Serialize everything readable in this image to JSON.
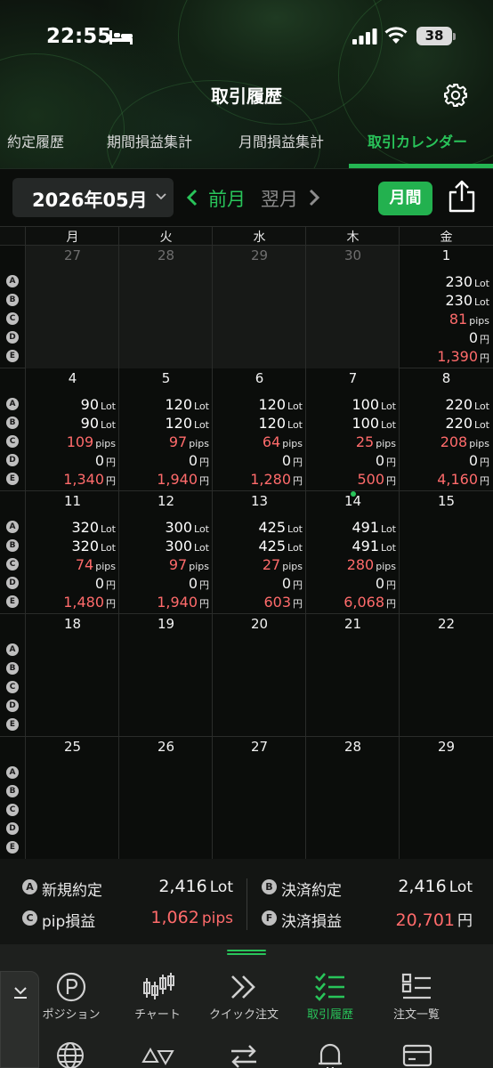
{
  "status": {
    "time": "22:55",
    "battery": "38"
  },
  "header": {
    "title": "取引履歴"
  },
  "tabs": [
    {
      "label": "約定履歴"
    },
    {
      "label": "期間損益集計"
    },
    {
      "label": "月間損益集計"
    },
    {
      "label": "取引カレンダー"
    }
  ],
  "month_bar": {
    "month": "2026年05月",
    "prev_label": "前月",
    "next_label": "翌月",
    "monthly_label": "月間"
  },
  "calendar": {
    "weekdays": [
      "月",
      "火",
      "水",
      "木",
      "金"
    ],
    "row_keys": [
      "A",
      "B",
      "C",
      "D",
      "E"
    ],
    "weeks": [
      {
        "days": [
          {
            "date": "27",
            "other_month": true
          },
          {
            "date": "28",
            "other_month": true
          },
          {
            "date": "29",
            "other_month": true
          },
          {
            "date": "30",
            "other_month": true
          },
          {
            "date": "1",
            "a": "230",
            "b": "230",
            "c": "81",
            "d": "0",
            "e": "1,390"
          }
        ]
      },
      {
        "days": [
          {
            "date": "4",
            "a": "90",
            "b": "90",
            "c": "109",
            "d": "0",
            "e": "1,340"
          },
          {
            "date": "5",
            "a": "120",
            "b": "120",
            "c": "97",
            "d": "0",
            "e": "1,940"
          },
          {
            "date": "6",
            "a": "120",
            "b": "120",
            "c": "64",
            "d": "0",
            "e": "1,280"
          },
          {
            "date": "7",
            "a": "100",
            "b": "100",
            "c": "25",
            "d": "0",
            "e": "500"
          },
          {
            "date": "8",
            "a": "220",
            "b": "220",
            "c": "208",
            "d": "0",
            "e": "4,160"
          }
        ]
      },
      {
        "days": [
          {
            "date": "11",
            "a": "320",
            "b": "320",
            "c": "74",
            "d": "0",
            "e": "1,480"
          },
          {
            "date": "12",
            "a": "300",
            "b": "300",
            "c": "97",
            "d": "0",
            "e": "1,940"
          },
          {
            "date": "13",
            "a": "425",
            "b": "425",
            "c": "27",
            "d": "0",
            "e": "603"
          },
          {
            "date": "14",
            "today": true,
            "a": "491",
            "b": "491",
            "c": "280",
            "d": "0",
            "e": "6,068"
          },
          {
            "date": "15"
          }
        ]
      },
      {
        "days": [
          {
            "date": "18"
          },
          {
            "date": "19"
          },
          {
            "date": "20"
          },
          {
            "date": "21"
          },
          {
            "date": "22"
          }
        ]
      },
      {
        "days": [
          {
            "date": "25"
          },
          {
            "date": "26"
          },
          {
            "date": "27"
          },
          {
            "date": "28"
          },
          {
            "date": "29"
          }
        ]
      }
    ],
    "units": {
      "lot": "Lot",
      "pips": "pips",
      "yen": "円"
    }
  },
  "summary": {
    "new_key": "A",
    "new_label": "新規約定",
    "new_value": "2,416",
    "new_unit": "Lot",
    "close_key": "B",
    "close_label": "決済約定",
    "close_value": "2,416",
    "close_unit": "Lot",
    "pip_key": "C",
    "pip_label": "pip損益",
    "pip_value": "1,062",
    "pip_unit": "pips",
    "pl_key": "F",
    "pl_label": "決済損益",
    "pl_value": "20,701",
    "pl_unit": "円"
  },
  "bottom_nav": [
    {
      "label": "ポジション",
      "icon": "position-icon"
    },
    {
      "label": "チャート",
      "icon": "candlestick-icon"
    },
    {
      "label": "クイック注文",
      "icon": "double-chevron-icon"
    },
    {
      "label": "取引履歴",
      "icon": "checklist-icon",
      "active": true
    },
    {
      "label": "注文一覧",
      "icon": "order-list-icon"
    }
  ],
  "colors": {
    "accent": "#24b552",
    "loss": "#ff6b6b"
  }
}
